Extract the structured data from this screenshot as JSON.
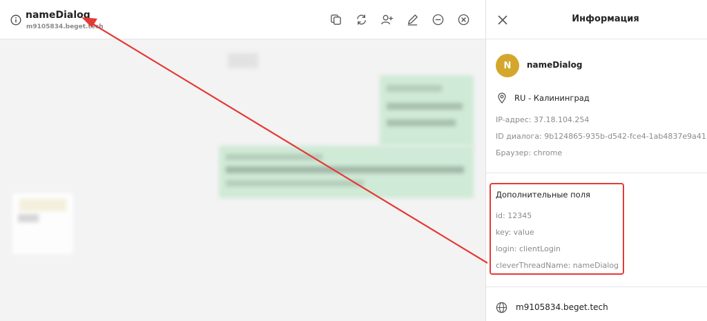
{
  "chat": {
    "title": "nameDialog",
    "subtitle": "m9105834.beget.tech",
    "toolbar": [
      {
        "icon": "copy-icon"
      },
      {
        "icon": "refresh-icon"
      },
      {
        "icon": "add-user-icon"
      },
      {
        "icon": "edit-icon"
      },
      {
        "icon": "minus-circle-icon"
      },
      {
        "icon": "close-circle-icon"
      }
    ]
  },
  "panel": {
    "title": "Информация",
    "avatar_letter": "N",
    "client_name": "nameDialog",
    "location": "RU - Калининград",
    "ip": "IP-адрес: 37.18.104.254",
    "dialog_id": "ID диалога: 9b124865-935b-d542-fce4-1ab4837e9a41",
    "browser": "Браузер: chrome",
    "extra_title": "Дополнительные поля",
    "extra_fields": [
      "id: 12345",
      "key: value",
      "login: clientLogin",
      "cleverThreadName: nameDialog"
    ],
    "site": "m9105834.beget.tech"
  },
  "colors": {
    "accent_red": "#e53935",
    "avatar": "#d4a72c",
    "bubble_green": "#cfead6"
  }
}
